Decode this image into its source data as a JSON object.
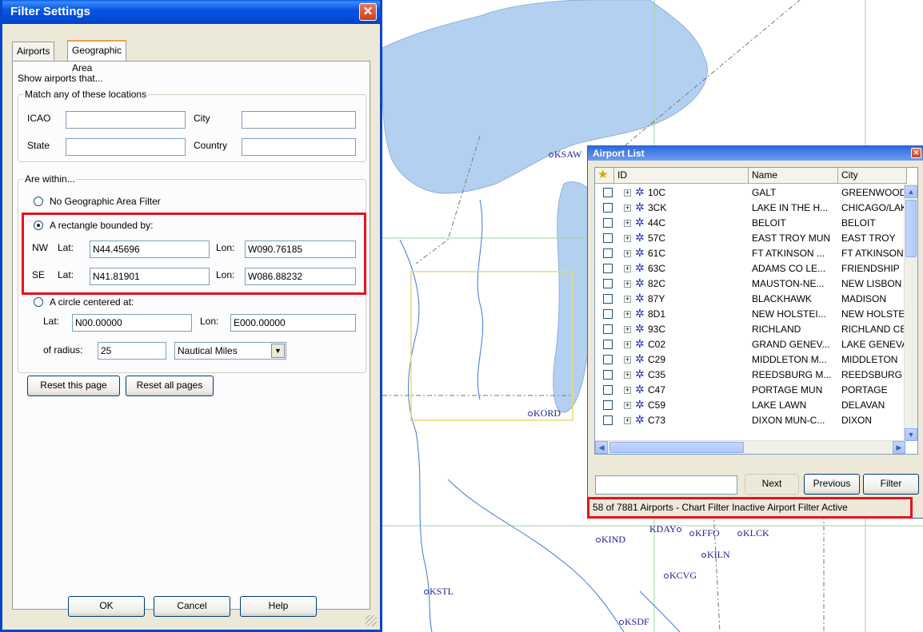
{
  "map": {
    "labels": [
      "KSAW",
      "KORD",
      "KIND",
      "KDAY",
      "KFFO",
      "KLCK",
      "KILN",
      "KCVG",
      "KSTL",
      "KSDF"
    ]
  },
  "filter_dialog": {
    "title": "Filter Settings",
    "tabs": [
      "Airports",
      "Geographic Area"
    ],
    "active_tab": "Geographic Area",
    "show_airports_text": "Show airports that...",
    "match_group_legend": "Match any of these locations",
    "icao_label": "ICAO",
    "icao_value": "",
    "city_label": "City",
    "city_value": "",
    "state_label": "State",
    "state_value": "",
    "country_label": "Country",
    "country_value": "",
    "within_group_legend": "Are within...",
    "no_filter_label": "No Geographic Area Filter",
    "rectangle_label": "A rectangle bounded by:",
    "nw_label": "NW",
    "se_label": "SE",
    "lat_label": "Lat:",
    "lon_label": "Lon:",
    "nw_lat": "N44.45696",
    "nw_lon": "W090.76185",
    "se_lat": "N41.81901",
    "se_lon": "W086.88232",
    "circle_label": "A circle centered at:",
    "circle_lat": "N00.00000",
    "circle_lon": "E000.00000",
    "radius_label": "of radius:",
    "radius_value": "25",
    "radius_unit": "Nautical Miles",
    "reset_page_label": "Reset this page",
    "reset_all_label": "Reset all pages",
    "ok_label": "OK",
    "cancel_label": "Cancel",
    "help_label": "Help",
    "selected_option": "rectangle"
  },
  "airport_list": {
    "title": "Airport List",
    "columns": [
      "ID",
      "Name",
      "City"
    ],
    "rows": [
      {
        "id": "10C",
        "name": "GALT",
        "city": "GREENWOOD"
      },
      {
        "id": "3CK",
        "name": "LAKE IN THE H...",
        "city": "CHICAGO/LAKE"
      },
      {
        "id": "44C",
        "name": "BELOIT",
        "city": "BELOIT"
      },
      {
        "id": "57C",
        "name": "EAST TROY MUN",
        "city": "EAST TROY"
      },
      {
        "id": "61C",
        "name": "FT ATKINSON ...",
        "city": "FT ATKINSON"
      },
      {
        "id": "63C",
        "name": "ADAMS CO LE...",
        "city": "FRIENDSHIP"
      },
      {
        "id": "82C",
        "name": "MAUSTON-NE...",
        "city": "NEW LISBON"
      },
      {
        "id": "87Y",
        "name": "BLACKHAWK",
        "city": "MADISON"
      },
      {
        "id": "8D1",
        "name": "NEW HOLSTEI...",
        "city": "NEW HOLSTEIN"
      },
      {
        "id": "93C",
        "name": "RICHLAND",
        "city": "RICHLAND CENTER"
      },
      {
        "id": "C02",
        "name": "GRAND GENEV...",
        "city": "LAKE GENEVA"
      },
      {
        "id": "C29",
        "name": "MIDDLETON M...",
        "city": "MIDDLETON"
      },
      {
        "id": "C35",
        "name": "REEDSBURG M...",
        "city": "REEDSBURG"
      },
      {
        "id": "C47",
        "name": "PORTAGE MUN",
        "city": "PORTAGE"
      },
      {
        "id": "C59",
        "name": "LAKE LAWN",
        "city": "DELAVAN"
      },
      {
        "id": "C73",
        "name": "DIXON MUN-C...",
        "city": "DIXON"
      }
    ],
    "search_value": "",
    "next_label": "Next",
    "previous_label": "Previous",
    "filter_label": "Filter",
    "status_text": "58 of 7881 Airports - Chart Filter Inactive  Airport Filter Active"
  },
  "colors": {
    "water": "#b3d0f0",
    "xp_blue": "#0a45c8",
    "highlight_red": "#e8121a",
    "map_label": "#1e1e96",
    "filter_rect": "#e8d870"
  }
}
